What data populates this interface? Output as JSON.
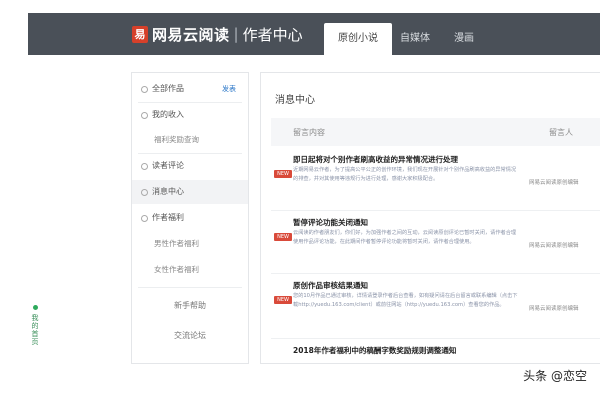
{
  "header": {
    "logo_glyph": "易",
    "brand": "网易云阅读",
    "separator": "|",
    "section": "作者中心",
    "tabs": [
      {
        "label": "原创小说",
        "active": true
      },
      {
        "label": "自媒体",
        "active": false
      },
      {
        "label": "漫画",
        "active": false
      }
    ]
  },
  "side_mark": {
    "text": "我的首页"
  },
  "sidebar": {
    "items": [
      {
        "label": "全部作品",
        "extra": "发表",
        "type": "top"
      },
      {
        "label": "我的收入",
        "type": "top"
      },
      {
        "label": "福利奖励查询",
        "type": "sub"
      },
      {
        "label": "读者评论",
        "type": "top"
      },
      {
        "label": "消息中心",
        "type": "top",
        "active": true
      },
      {
        "label": "作者福利",
        "type": "top"
      },
      {
        "label": "男性作者福利",
        "type": "sub"
      },
      {
        "label": "女性作者福利",
        "type": "sub"
      },
      {
        "label": "新手帮助",
        "type": "center"
      },
      {
        "label": "交流论坛",
        "type": "center"
      }
    ]
  },
  "main": {
    "title": "消息中心",
    "columns": [
      "留言内容",
      "留言人"
    ],
    "rows": [
      {
        "title": "即日起将对个别作者刷高收益的异常情况进行处理",
        "body": "近期网易云作者，为了提高公平公正的创作环境，我们现在开展针对个别作品刷高收益的异常情况的排查，并对其使用等违规行为进行处理，感谢大家积极配合。",
        "badge": "NEW",
        "author": "网易云阅读原创编辑"
      },
      {
        "title": "暂停评论功能关闭通知",
        "body": "云阅读的作者朋友们，你们好，为加强作者之间的互动，云阅读原创评论已暂时关闭，请作者合理使用作品评论功能，在此期间作者暂停评论功能将暂时关闭，请作者合理使用。",
        "badge": "NEW",
        "author": "网易云阅读原创编辑"
      },
      {
        "title": "原创作品审核结果通知",
        "body": "您的10月作品已通过审核，详情请登录作者后台查看，如有疑问请在后台留言或联系编辑（点击下载http://yuedu.163.com/client）或前往网站（http://yuedu.163.com）查看您的作品。",
        "badge": "NEW",
        "author": "网易云阅读原创编辑"
      },
      {
        "title": "2018年作者福利中的稿酬字数奖励规则调整通知",
        "body": "",
        "badge": "",
        "author": ""
      }
    ]
  },
  "watermark": "头条 @恋空"
}
